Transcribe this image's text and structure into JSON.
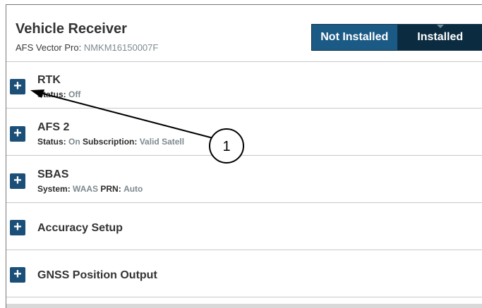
{
  "header": {
    "title": "Vehicle Receiver",
    "subtitle_prefix": "AFS Vector Pro:",
    "serial": "NMKM16150007F",
    "toggle": {
      "not_installed": "Not Installed",
      "installed": "Installed"
    }
  },
  "rows": [
    {
      "title": "RTK",
      "detail": [
        {
          "label": "Status:",
          "value": "Off"
        }
      ]
    },
    {
      "title": "AFS 2",
      "detail": [
        {
          "label": "Status:",
          "value": "On"
        },
        {
          "label": "Subscription:",
          "value": "Valid"
        },
        {
          "label": "Satell",
          "value": ""
        }
      ]
    },
    {
      "title": "SBAS",
      "detail": [
        {
          "label": "System:",
          "value": "WAAS"
        },
        {
          "label": "PRN:",
          "value": "Auto"
        }
      ]
    },
    {
      "title": "Accuracy Setup"
    },
    {
      "title": "GNSS Position Output"
    }
  ],
  "plus_icon": "+",
  "callout": {
    "number": "1"
  }
}
